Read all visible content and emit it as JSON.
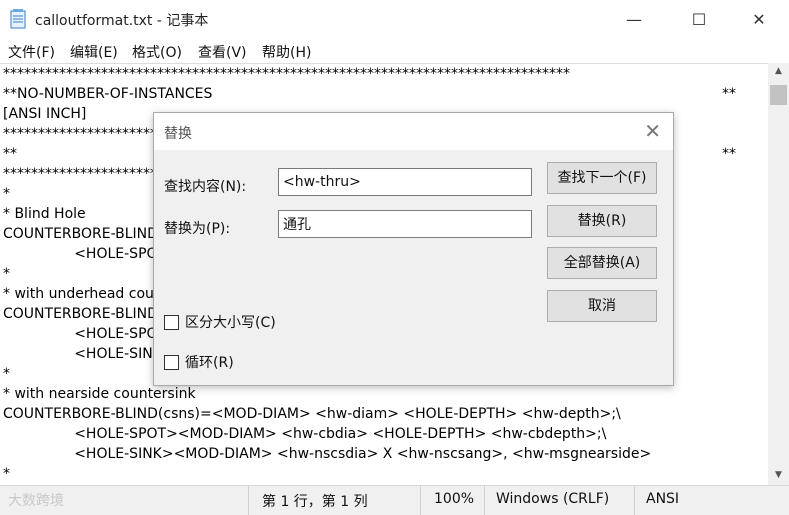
{
  "window": {
    "title": "calloutformat.txt - 记事本",
    "controls": {
      "minimize": "—",
      "maximize": "☐",
      "close": "✕"
    }
  },
  "menu": [
    "文件(F)",
    "编辑(E)",
    "格式(O)",
    "查看(V)",
    "帮助(H)"
  ],
  "editor": {
    "lines": [
      "*********************************************************************************",
      "**NO-NUMBER-OF-INSTANCES",
      "[ANSI INCH]",
      "***********************",
      "**",
      "***********************",
      "*",
      "* Blind Hole",
      "COUNTERBORE-BLIND",
      "                <HOLE-SPO",
      "*",
      "* with underhead cou",
      "COUNTERBORE-BLIND",
      "                <HOLE-SPO",
      "                <HOLE-SINK",
      "*",
      "* with nearside countersink",
      "COUNTERBORE-BLIND(csns)=<MOD-DIAM> <hw-diam> <HOLE-DEPTH> <hw-depth>;\\",
      "                <HOLE-SPOT><MOD-DIAM> <hw-cbdia> <HOLE-DEPTH> <hw-cbdepth>;\\",
      "                <HOLE-SINK><MOD-DIAM> <hw-nscsdia> X <hw-nscsang>, <hw-msgnearside>",
      "*"
    ],
    "right_marks": [
      "**",
      "**"
    ]
  },
  "status": {
    "position": "第 1 行，第 1 列",
    "zoom": "100%",
    "line_ending": "Windows (CRLF)",
    "encoding": "ANSI",
    "watermark": "大数跨境"
  },
  "dialog": {
    "title": "替换",
    "find_label": "查找内容(N):",
    "find_value": "<hw-thru>",
    "replace_label": "替换为(P):",
    "replace_value": "通孔",
    "buttons": {
      "find_next": "查找下一个(F)",
      "replace": "替换(R)",
      "replace_all": "全部替换(A)",
      "cancel": "取消"
    },
    "match_case": "区分大小写(C)",
    "wrap": "循环(R)"
  }
}
